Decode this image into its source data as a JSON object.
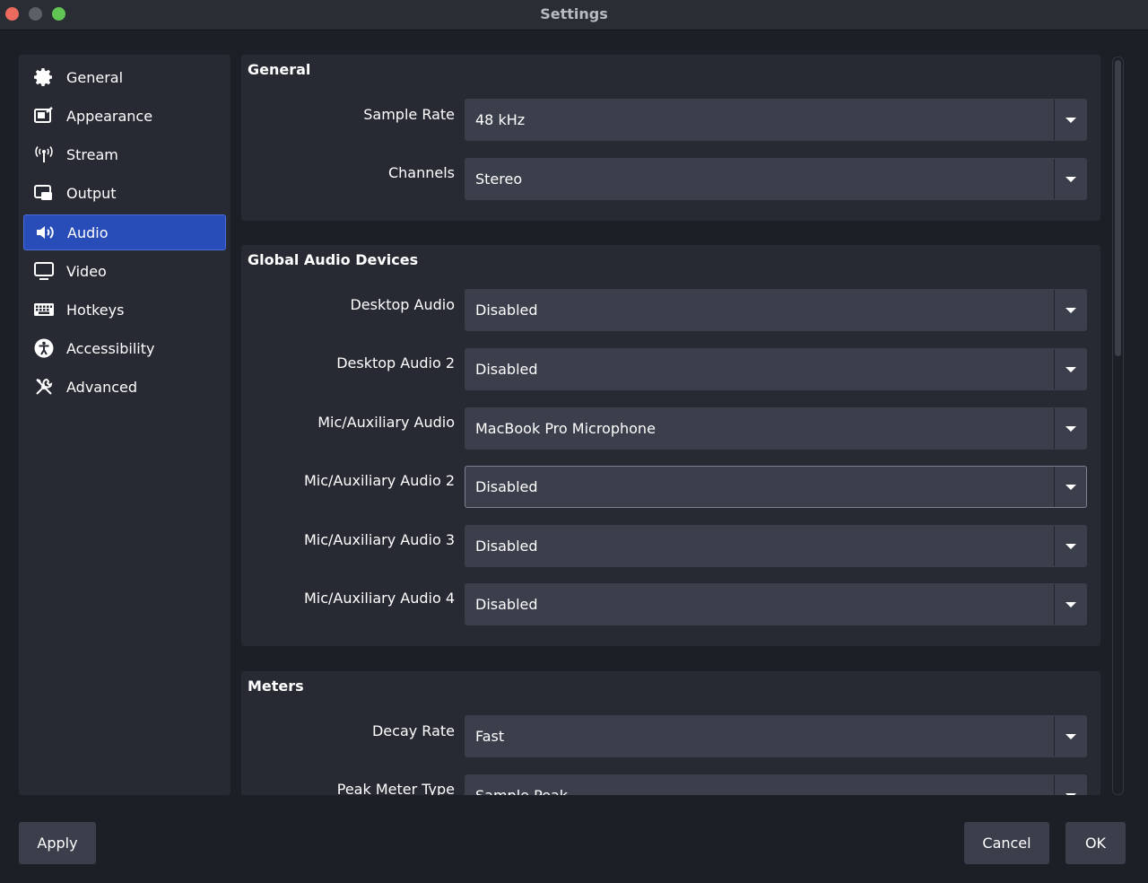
{
  "window": {
    "title": "Settings"
  },
  "sidebar": {
    "items": [
      {
        "label": "General",
        "icon": "gear-icon",
        "active": false
      },
      {
        "label": "Appearance",
        "icon": "appearance-icon",
        "active": false
      },
      {
        "label": "Stream",
        "icon": "antenna-icon",
        "active": false
      },
      {
        "label": "Output",
        "icon": "output-icon",
        "active": false
      },
      {
        "label": "Audio",
        "icon": "speaker-icon",
        "active": true
      },
      {
        "label": "Video",
        "icon": "monitor-icon",
        "active": false
      },
      {
        "label": "Hotkeys",
        "icon": "keyboard-icon",
        "active": false
      },
      {
        "label": "Accessibility",
        "icon": "accessibility-icon",
        "active": false
      },
      {
        "label": "Advanced",
        "icon": "tools-icon",
        "active": false
      }
    ],
    "active_color": "#284cb8"
  },
  "general": {
    "title": "General",
    "sample_rate": {
      "label": "Sample Rate",
      "value": "48 kHz"
    },
    "channels": {
      "label": "Channels",
      "value": "Stereo"
    }
  },
  "devices": {
    "title": "Global Audio Devices",
    "desktop_audio": {
      "label": "Desktop Audio",
      "value": "Disabled"
    },
    "desktop_audio_2": {
      "label": "Desktop Audio 2",
      "value": "Disabled"
    },
    "mic_aux": {
      "label": "Mic/Auxiliary Audio",
      "value": "MacBook Pro Microphone"
    },
    "mic_aux_2": {
      "label": "Mic/Auxiliary Audio 2",
      "value": "Disabled"
    },
    "mic_aux_3": {
      "label": "Mic/Auxiliary Audio 3",
      "value": "Disabled"
    },
    "mic_aux_4": {
      "label": "Mic/Auxiliary Audio 4",
      "value": "Disabled"
    }
  },
  "meters": {
    "title": "Meters",
    "decay_rate": {
      "label": "Decay Rate",
      "value": "Fast"
    },
    "peak_meter_type": {
      "label": "Peak Meter Type",
      "value": "Sample Peak"
    }
  },
  "buttons": {
    "apply": "Apply",
    "cancel": "Cancel",
    "ok": "OK"
  }
}
